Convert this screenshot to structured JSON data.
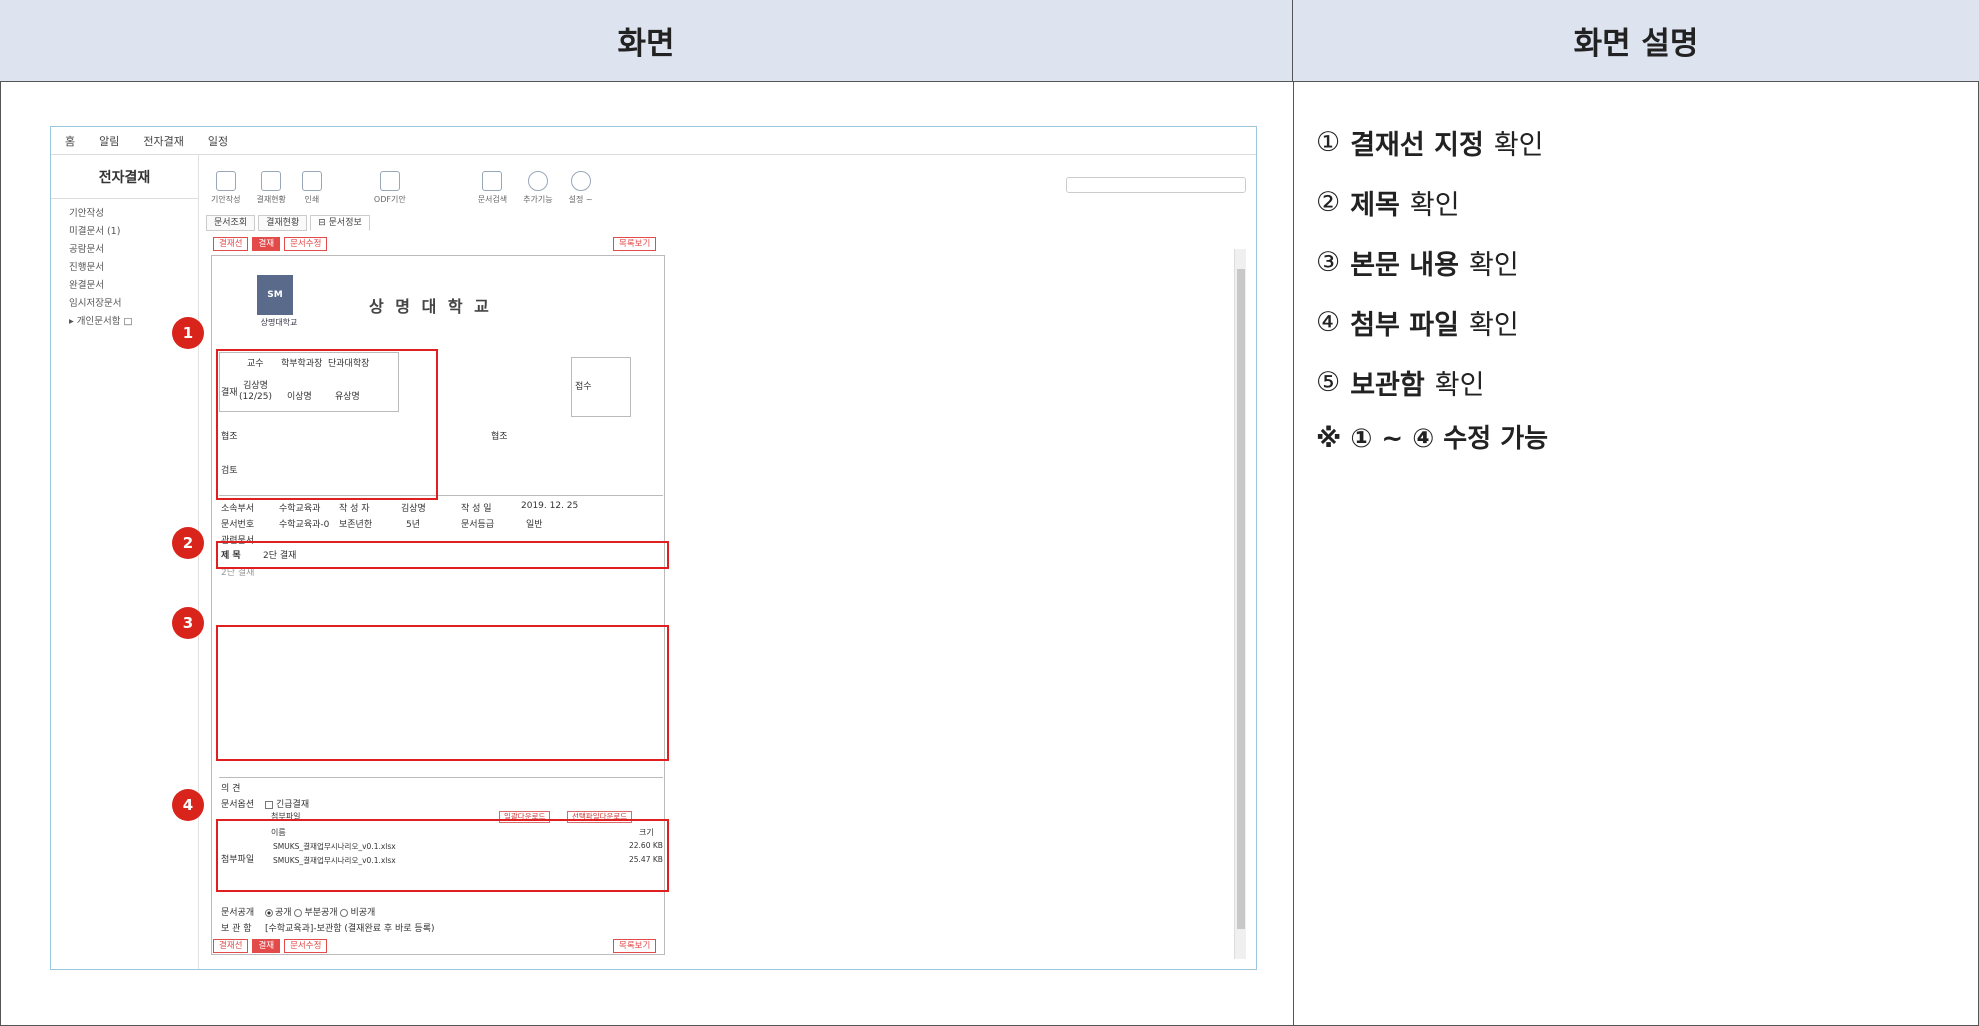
{
  "header": {
    "left_title": "화면",
    "right_title": "화면 설명"
  },
  "description": {
    "items": [
      {
        "num": "①",
        "bold": "결재선 지정",
        "rest": "확인"
      },
      {
        "num": "②",
        "bold": "제목",
        "rest": "확인"
      },
      {
        "num": "③",
        "bold": "본문 내용",
        "rest": "확인"
      },
      {
        "num": "④",
        "bold": "첨부 파일",
        "rest": "확인"
      },
      {
        "num": "⑤",
        "bold": "보관함",
        "rest": "확인"
      }
    ],
    "note": "※ ① ~ ④ 수정 가능"
  },
  "app": {
    "topnav": [
      "홈",
      "알림",
      "전자결재",
      "일정"
    ],
    "sidebar": {
      "title": "전자결재",
      "items": [
        "기안작성",
        "미결문서 (1)",
        "공람문서",
        "진행문서",
        "완결문서",
        "임시저장문서",
        "▸ 개인문서함 □"
      ]
    },
    "toolbar": [
      "기안작성",
      "결재현황",
      "인쇄",
      "",
      "ODF기안",
      "문서검색",
      "추가기능",
      "설정 ~"
    ],
    "subtabs": [
      "문서조회",
      "결재현황",
      "⊟ 문서정보"
    ],
    "buttons": {
      "line": "결재선",
      "approve": "결재",
      "docinfo": "문서수정",
      "list": "목록보기"
    },
    "doc": {
      "university": "상 명 대 학 교",
      "logo_text": "상명대학교",
      "approval_header": [
        "교수",
        "학부학과장",
        "단과대학장"
      ],
      "approval_label": "결재",
      "approvers": [
        "김상명\n(12/25)",
        "이상명",
        "유상명"
      ],
      "receive_label": "접수",
      "coop_label": "협조",
      "coop_label2": "협조",
      "review_label": "검토",
      "info": {
        "dept_label": "소속부서",
        "dept": "수학교육과",
        "writer_label": "작 성 자",
        "writer": "김상명",
        "date_label": "작 성 일",
        "date": "2019. 12. 25",
        "no_label": "문서번호",
        "no": "수학교육과-0",
        "keep_label": "보존년한",
        "keep": "5년",
        "grade_label": "문서등급",
        "grade": "일반",
        "related_label": "관련문서"
      },
      "title_label": "제    목",
      "title": "2단 결재",
      "body": "2단 결재",
      "opinion_label": "의    견",
      "options_label": "문서옵션",
      "urgent": "긴급결재",
      "attach_label": "첨부파일",
      "attach_head": "첨부파일",
      "attach_btn1": "일괄다운로드",
      "attach_btn2": "선택파일다운로드",
      "attach_cols": [
        "이름",
        "크기"
      ],
      "files": [
        {
          "name": "SMUKS_결재업무시나리오_v0.1.xlsx",
          "size": "22.60 KB"
        },
        {
          "name": "SMUKS_결재업무시나리오_v0.1.xlsx",
          "size": "25.47 KB"
        }
      ],
      "public_label": "문서공개",
      "public_opts": [
        "공개",
        "부분공개",
        "비공개"
      ],
      "storage_label": "보 관 함",
      "storage": "[수학교육과]-보관함 (결재완료 후 바로 등록)"
    },
    "badges": [
      "1",
      "2",
      "3",
      "4"
    ]
  },
  "colors": {
    "header_bg": "#dde3ef",
    "highlight": "#e02020",
    "badge": "#d9241b"
  }
}
